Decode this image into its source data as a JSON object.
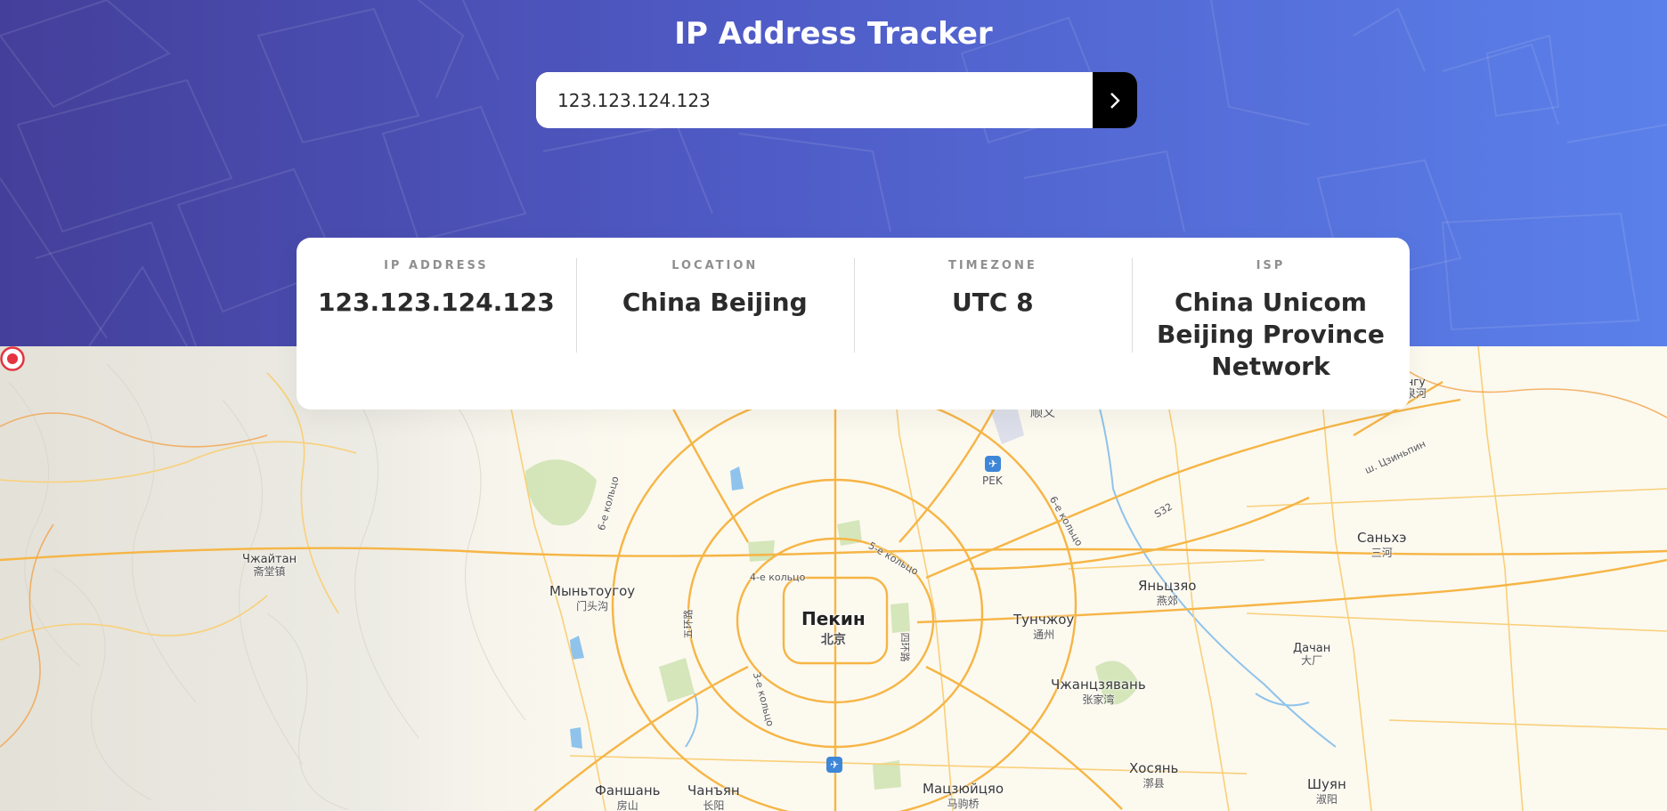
{
  "header": {
    "title": "IP Address Tracker"
  },
  "search": {
    "value": "123.123.124.123",
    "submit_icon": "chevron-right-icon"
  },
  "info": {
    "ip_label": "IP ADDRESS",
    "ip_value": "123.123.124.123",
    "location_label": "LOCATION",
    "location_value": "China Beijing",
    "timezone_label": "TIMEZONE",
    "timezone_value": "UTC 8",
    "isp_label": "ISP",
    "isp_value": "China Unicom Beijing Province Network"
  },
  "map": {
    "places": {
      "pekin": {
        "name": "Пекин",
        "sub": "北京"
      },
      "myntougou": {
        "name": "Мыньтоугоу",
        "sub": "门头沟"
      },
      "zhaytan": {
        "name": "Чжайтан",
        "sub": "斋堂镇"
      },
      "tunchzhou": {
        "name": "Тунчжоу",
        "sub": "通州"
      },
      "yanczyao": {
        "name": "Яньцзяо",
        "sub": "燕郊"
      },
      "sanhe": {
        "name": "Саньхэ",
        "sub": "三河"
      },
      "dachan": {
        "name": "Дачан",
        "sub": "大厂"
      },
      "zhangjiawan": {
        "name": "Чжанцзявань",
        "sub": "张家湾"
      },
      "hosyan": {
        "name": "Хосянь",
        "sub": "漷县"
      },
      "shuyan": {
        "name": "Шуян",
        "sub": "淑阳"
      },
      "fanshan": {
        "name": "Фаншань",
        "sub": "房山"
      },
      "changyan": {
        "name": "Чанъян",
        "sub": "长阳"
      },
      "majuqiao": {
        "name": "Мацзюйцяо",
        "sub": "马驹桥"
      },
      "shunyi": {
        "name": "",
        "sub": "顺义"
      },
      "pingu": {
        "name": "нгу",
        "sub": "泉河"
      }
    },
    "roads": {
      "ring6_a": "6-е кольцо",
      "ring6_b": "6-е кольцо",
      "ring5": "5-е кольцо",
      "ring4": "4-е кольцо",
      "ring3": "3-е кольцо",
      "ring5_cn": "五环路",
      "ring4_cn": "四环路",
      "s32": "S32",
      "jingping": "ш. Цзиньпин"
    },
    "airport_code": "PEK",
    "marker_icon": "location-target-icon",
    "colors": {
      "road_major": "#f6b545",
      "road_minor": "#f9d07a",
      "water": "#8fc3ec",
      "park": "#cfe3b4",
      "marker": "#e3343f"
    }
  }
}
